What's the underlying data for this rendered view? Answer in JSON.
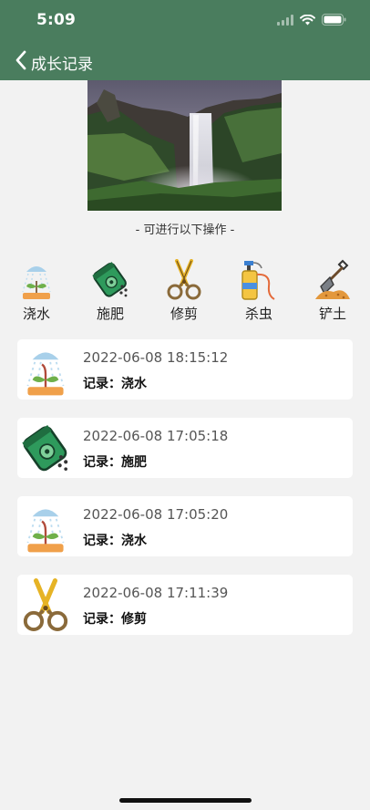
{
  "status_bar": {
    "time": "5:09"
  },
  "nav": {
    "title": "成长记录"
  },
  "subtitle": "- 可进行以下操作 -",
  "actions": [
    {
      "label": "浇水",
      "icon": "watering-icon"
    },
    {
      "label": "施肥",
      "icon": "fertilizer-icon"
    },
    {
      "label": "修剪",
      "icon": "scissors-icon"
    },
    {
      "label": "杀虫",
      "icon": "spray-icon"
    },
    {
      "label": "铲土",
      "icon": "shovel-icon"
    }
  ],
  "records": [
    {
      "time": "2022-06-08 18:15:12",
      "text": "记录：浇水",
      "icon": "watering-icon"
    },
    {
      "time": "2022-06-08 17:05:18",
      "text": "记录：施肥",
      "icon": "fertilizer-icon"
    },
    {
      "time": "2022-06-08 17:05:20",
      "text": "记录：浇水",
      "icon": "watering-icon"
    },
    {
      "time": "2022-06-08 17:11:39",
      "text": "记录：修剪",
      "icon": "scissors-icon"
    }
  ],
  "colors": {
    "header": "#4a7d5e",
    "background": "#f2f2f2",
    "card": "#ffffff"
  }
}
